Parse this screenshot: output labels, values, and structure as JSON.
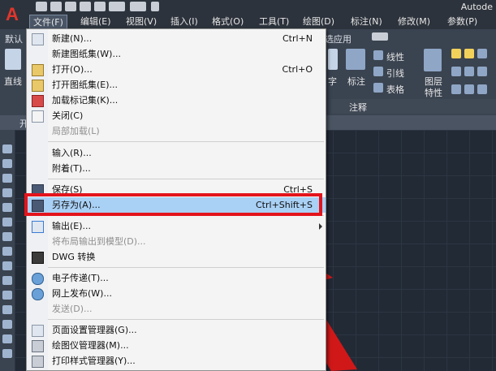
{
  "app": {
    "title": "Autode"
  },
  "menubar": {
    "items": [
      "文件(F)",
      "编辑(E)",
      "视图(V)",
      "插入(I)",
      "格式(O)",
      "工具(T)",
      "绘图(D)",
      "标注(N)",
      "修改(M)",
      "参数(P)"
    ]
  },
  "ribbon": {
    "tab_default": "默认",
    "tab_partial": "选应用",
    "draw_line_label": "直线",
    "text_label": "字",
    "dimension_label": "标注",
    "linear_label": "线性",
    "leader_label": "引线",
    "table_label": "表格",
    "layer_props_label1": "图层",
    "layer_props_label2": "特性",
    "annotation_panel": "注释"
  },
  "doc_tab": {
    "label": "开"
  },
  "file_menu": {
    "items": [
      {
        "label": "新建(N)...",
        "shortcut": "Ctrl+N",
        "disabled": false
      },
      {
        "label": "新建图纸集(W)...",
        "shortcut": "",
        "disabled": false
      },
      {
        "label": "打开(O)...",
        "shortcut": "Ctrl+O",
        "disabled": false
      },
      {
        "label": "打开图纸集(E)...",
        "shortcut": "",
        "disabled": false
      },
      {
        "label": "加载标记集(K)...",
        "shortcut": "",
        "disabled": false
      },
      {
        "label": "关闭(C)",
        "shortcut": "",
        "disabled": false
      },
      {
        "label": "局部加载(L)",
        "shortcut": "",
        "disabled": true
      },
      {
        "label": "输入(R)...",
        "shortcut": "",
        "disabled": false
      },
      {
        "label": "附着(T)...",
        "shortcut": "",
        "disabled": false
      },
      {
        "label": "保存(S)",
        "shortcut": "Ctrl+S",
        "disabled": false
      },
      {
        "label": "另存为(A)...",
        "shortcut": "Ctrl+Shift+S",
        "disabled": false
      },
      {
        "label": "输出(E)...",
        "shortcut": "",
        "disabled": false
      },
      {
        "label": "将布局输出到模型(D)...",
        "shortcut": "",
        "disabled": true
      },
      {
        "label": "DWG 转换",
        "shortcut": "",
        "disabled": false
      },
      {
        "label": "电子传递(T)...",
        "shortcut": "",
        "disabled": false
      },
      {
        "label": "网上发布(W)...",
        "shortcut": "",
        "disabled": false
      },
      {
        "label": "发送(D)...",
        "shortcut": "",
        "disabled": true
      },
      {
        "label": "页面设置管理器(G)...",
        "shortcut": "",
        "disabled": false
      },
      {
        "label": "绘图仪管理器(M)...",
        "shortcut": "",
        "disabled": false
      },
      {
        "label": "打印样式管理器(Y)...",
        "shortcut": "",
        "disabled": false
      }
    ]
  },
  "colors": {
    "highlight_border": "#e3141c",
    "selected_item": "#a9d0f5",
    "annotation_arrow": "#d01818"
  }
}
